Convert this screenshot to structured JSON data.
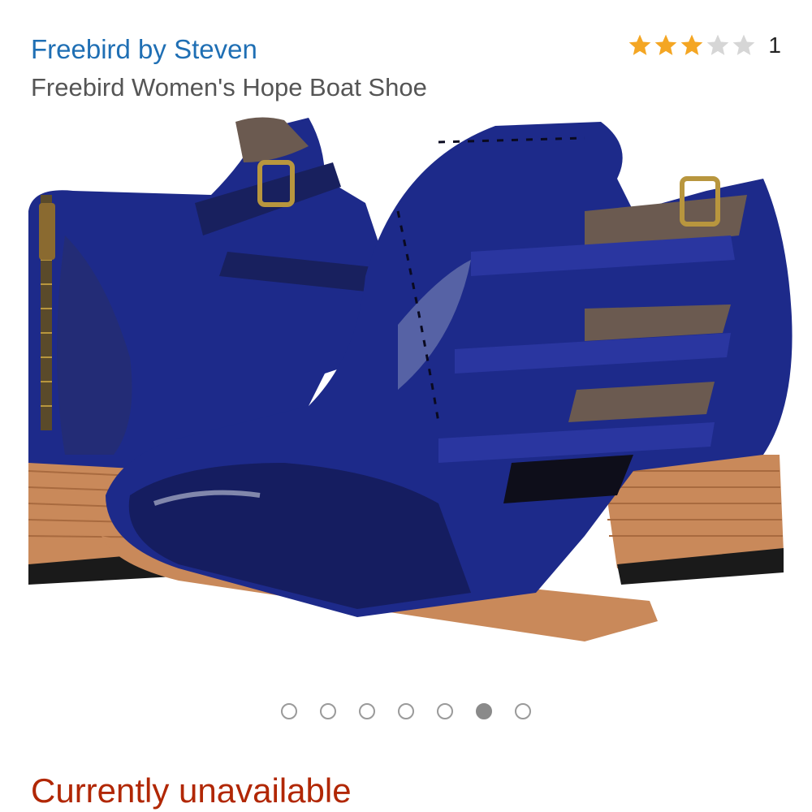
{
  "product": {
    "brand": "Freebird by Steven",
    "title": "Freebird Women's Hope Boat Shoe",
    "rating": {
      "stars": 3,
      "max_stars": 5,
      "review_count": "1"
    },
    "availability": "Currently unavailable"
  },
  "gallery": {
    "image_count": 7,
    "active_index": 5
  },
  "colors": {
    "brand_link": "#1f6fb4",
    "title_text": "#555555",
    "star_filled": "#f4a623",
    "star_empty": "#d6d6d6",
    "unavailable": "#b12704",
    "leather": "#1d2a8a",
    "heel_wood": "#c9895a"
  }
}
